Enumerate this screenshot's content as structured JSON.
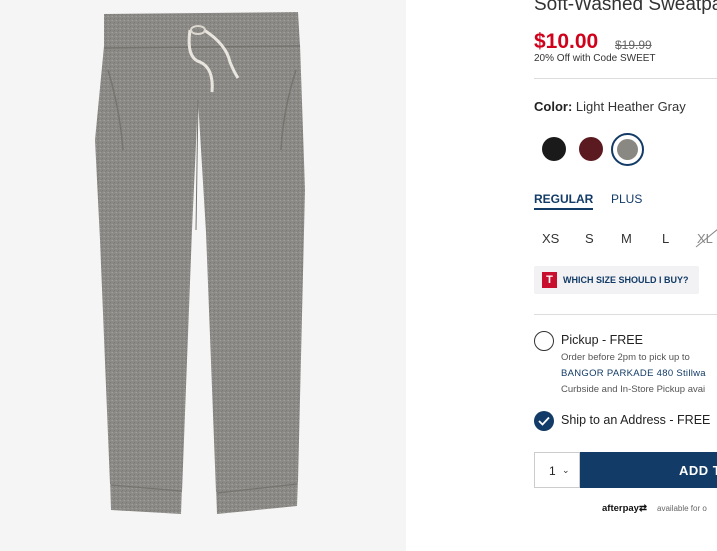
{
  "product": {
    "title": "Soft-Washed Sweatpa",
    "price": "$10.00",
    "original_price": "$19.99",
    "promo": "20% Off with Code SWEET"
  },
  "color": {
    "label": "Color:",
    "value": "Light Heather Gray",
    "swatches": [
      {
        "name": "black",
        "hex": "#1a1a1a",
        "selected": false
      },
      {
        "name": "maroon",
        "hex": "#5b1a1f",
        "selected": false
      },
      {
        "name": "light-heather-gray",
        "hex": "#8a8882",
        "selected": true
      }
    ]
  },
  "fit_tabs": {
    "regular": "REGULAR",
    "plus": "PLUS",
    "selected": "REGULAR"
  },
  "sizes": [
    "XS",
    "S",
    "M",
    "L",
    "XL"
  ],
  "sizes_unavailable": [
    "XL"
  ],
  "size_help": {
    "icon_letter": "T",
    "label": "WHICH SIZE SHOULD I BUY?"
  },
  "fulfillment": {
    "pickup_label": "Pickup - FREE",
    "pickup_sub": "Order before 2pm to pick up to",
    "store_link": "BANGOR PARKADE 480 Stillwa",
    "curbside": "Curbside and In-Store Pickup avai",
    "ship_label": "Ship to an Address - FREE",
    "selected": "ship"
  },
  "cart": {
    "quantity": "1",
    "add_label": "ADD T"
  },
  "afterpay": {
    "brand": "afterpay",
    "sub": "available for o"
  },
  "colors": {
    "navy": "#133b67",
    "sale_red": "#d0021b"
  }
}
